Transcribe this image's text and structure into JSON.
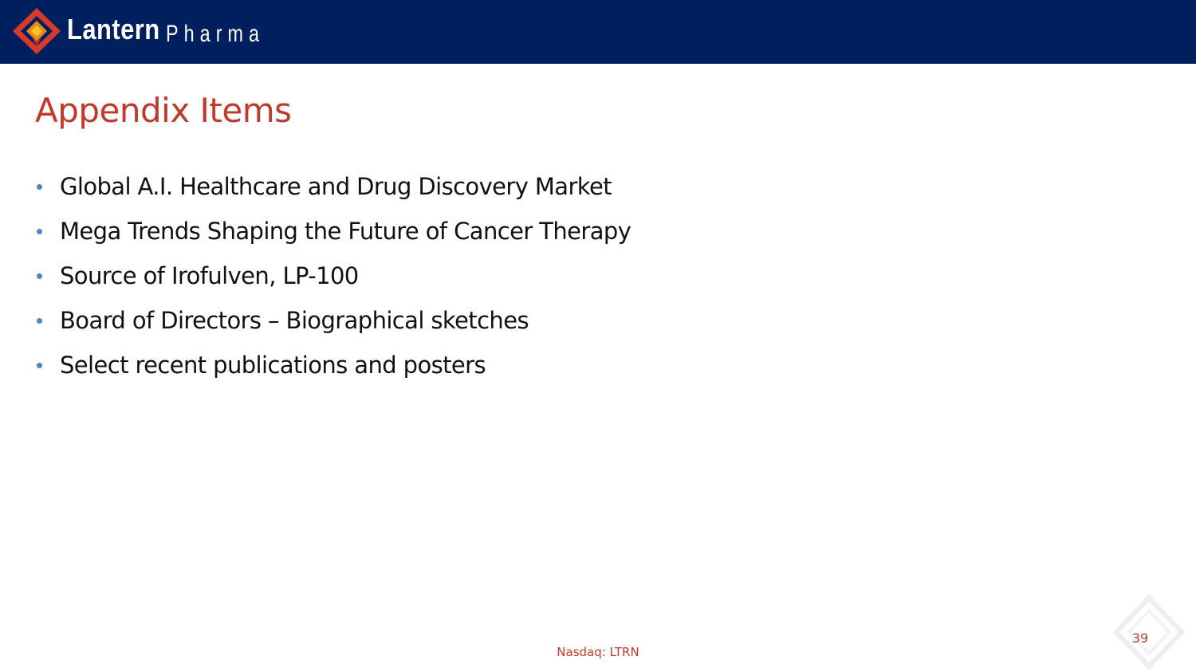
{
  "header": {
    "brand_name": "Lantern",
    "brand_sub": "Pharma",
    "background_color": "#001f5f",
    "logo_icon": "lantern-diamond-logo"
  },
  "slide": {
    "title": "Appendix Items",
    "title_color": "#c0392b",
    "bullets": [
      "Global A.I. Healthcare and Drug Discovery Market",
      "Mega Trends Shaping the Future of Cancer Therapy",
      "Source of Irofulven, LP-100",
      "Board of Directors – Biographical sketches",
      "Select recent publications and posters"
    ],
    "bullet_color": "#4a86c5"
  },
  "footer": {
    "ticker": "Nasdaq: LTRN",
    "page_number": "39",
    "watermark_icon": "lantern-diamond-watermark"
  }
}
